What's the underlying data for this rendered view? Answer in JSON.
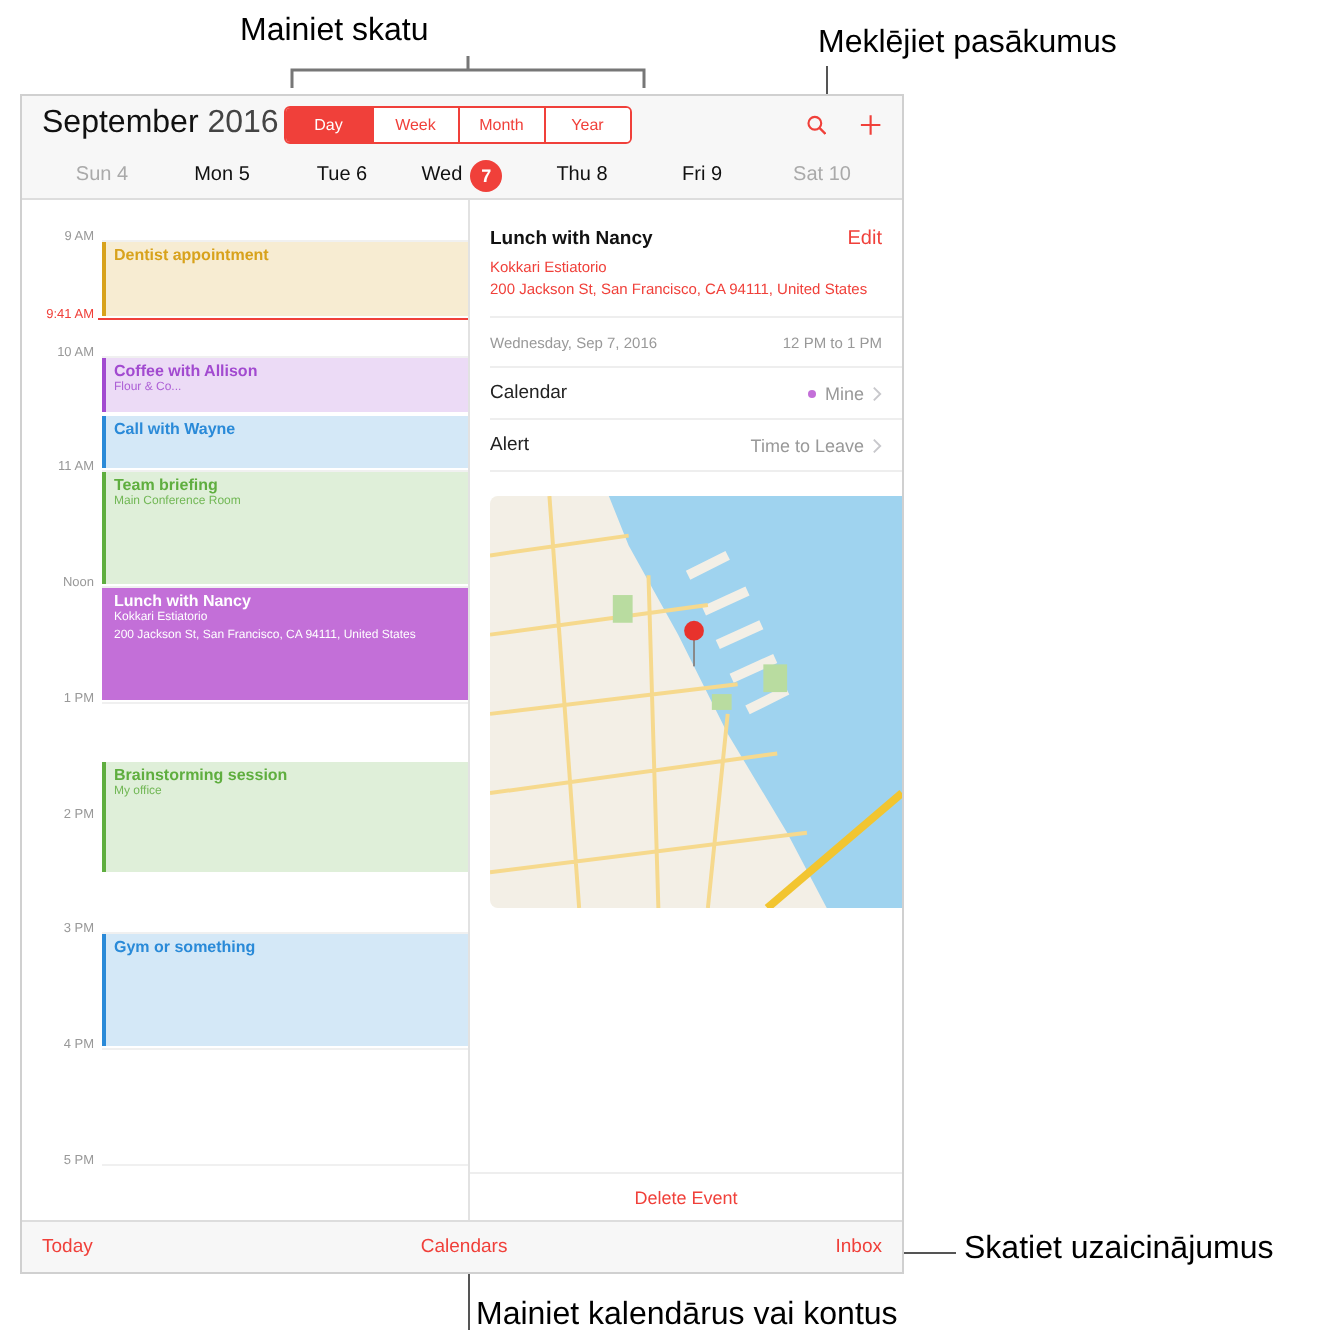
{
  "callouts": [
    {
      "kind": "bracket",
      "text": "Mainiet skatu"
    },
    {
      "kind": "down",
      "text": "Meklējiet pasākumus"
    },
    {
      "kind": "left",
      "text": "Skatiet uzaicinājumus"
    },
    {
      "kind": "up",
      "text": "Mainiet kalendārus vai kontus"
    }
  ],
  "header": {
    "month": "September",
    "year": "2016",
    "views": [
      {
        "label": "Day",
        "selected": true
      },
      {
        "label": "Week",
        "selected": false
      },
      {
        "label": "Month",
        "selected": false
      },
      {
        "label": "Year",
        "selected": false
      }
    ]
  },
  "days": [
    {
      "label": "Sun 4",
      "dimmed": true
    },
    {
      "label": "Mon 5",
      "dimmed": false
    },
    {
      "label": "Tue 6",
      "dimmed": false
    },
    {
      "label": "Wed",
      "badge": "7",
      "dimmed": false
    },
    {
      "label": "Thu 8",
      "dimmed": false
    },
    {
      "label": "Fri 9",
      "dimmed": false
    },
    {
      "label": "Sat 10",
      "dimmed": true
    }
  ],
  "hours": [
    "9 AM",
    "10 AM",
    "11 AM",
    "Noon",
    "1 PM",
    "2 PM",
    "3 PM",
    "4 PM",
    "5 PM"
  ],
  "now": "9:41 AM",
  "events": [
    {
      "title": "Dentist appointment",
      "color": "#d8a21c",
      "selected": false
    },
    {
      "title": "Coffee with Allison",
      "lines": [
        "Flour & Co..."
      ],
      "color": "#a24ad0",
      "selected": false
    },
    {
      "title": "Call with Wayne",
      "color": "#2a8ad8",
      "selected": false
    },
    {
      "title": "Team briefing",
      "lines": [
        "Main Conference Room"
      ],
      "color": "#5fae3f",
      "selected": false
    },
    {
      "title": "Lunch with Nancy",
      "lines": [
        "Kokkari Estiatorio",
        "200 Jackson St, San Francisco, CA  94111, United States"
      ],
      "color": "#c36fd8",
      "selected": true
    },
    {
      "title": "Brainstorming session",
      "lines": [
        "My office"
      ],
      "color": "#5fae3f",
      "selected": false
    },
    {
      "title": "Gym or something",
      "color": "#2a8ad8",
      "selected": false
    }
  ],
  "detail": {
    "title": "Lunch with Nancy",
    "edit": "Edit",
    "location": "Kokkari Estiatorio",
    "address": "200 Jackson St, San Francisco, CA  94111, United States",
    "date": "Wednesday, Sep 7, 2016",
    "time": "12 PM to 1 PM",
    "rows": [
      {
        "label": "Calendar",
        "value": "Mine",
        "color": "#c36fd8"
      },
      {
        "label": "Alert",
        "value": "Time to Leave"
      }
    ],
    "delete": "Delete Event"
  },
  "toolbar": [
    "Today",
    "Calendars",
    "Inbox"
  ]
}
